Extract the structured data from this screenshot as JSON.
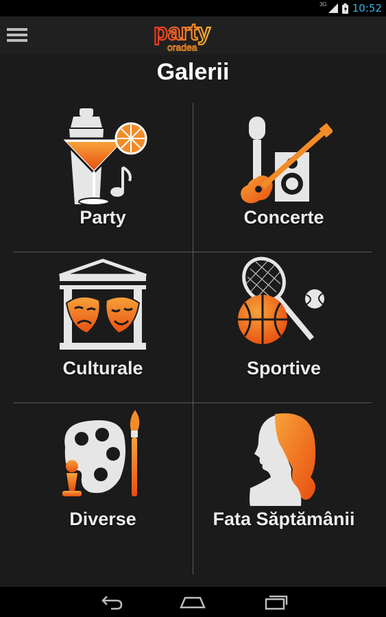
{
  "status_bar": {
    "time": "10:52",
    "network_label": "3G"
  },
  "header": {
    "logo_main": "party",
    "logo_sub": "oradea",
    "title": "Galerii"
  },
  "gallery": [
    {
      "label": "Party",
      "icon": "cocktail-icon"
    },
    {
      "label": "Concerte",
      "icon": "guitar-mic-speaker-icon"
    },
    {
      "label": "Culturale",
      "icon": "theatre-masks-icon"
    },
    {
      "label": "Sportive",
      "icon": "sports-balls-icon"
    },
    {
      "label": "Diverse",
      "icon": "palette-brush-icon"
    },
    {
      "label": "Fata Săptămânii",
      "icon": "woman-silhouette-icon"
    }
  ],
  "colors": {
    "accent": "#f28c28",
    "accent_dark": "#e35a12",
    "icon_gray": "#e6e6e6",
    "status_time": "#33b5e5"
  }
}
